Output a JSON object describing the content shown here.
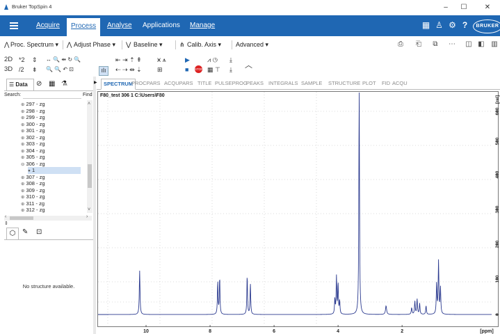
{
  "window": {
    "title": "Bruker TopSpin 4",
    "minimize": "–",
    "maximize": "☐",
    "close": "✕"
  },
  "menu": {
    "items": [
      "Acquire",
      "Process",
      "Analyse",
      "Applications",
      "Manage"
    ],
    "active": "Process",
    "brand": "BRUKER"
  },
  "toolbar1": {
    "proc_spectrum": "Proc. Spectrum ▾",
    "adjust_phase": "Adjust Phase ▾",
    "baseline": "Baseline ▾",
    "calib_axis": "Calib. Axis ▾",
    "advanced": "Advanced ▾"
  },
  "toolbar2": {
    "btn_2d": "2D",
    "btn_3d": "3D",
    "btn_mul2": "*2",
    "btn_div2": "/2",
    "stop": "STOP"
  },
  "left": {
    "tab_data": "Data",
    "search_label": "Search:",
    "find_label": "Find",
    "tree": [
      {
        "label": "297 - zg",
        "pm": "⊕"
      },
      {
        "label": "298 - zg",
        "pm": "⊕"
      },
      {
        "label": "299 - zg",
        "pm": "⊕"
      },
      {
        "label": "300 - zg",
        "pm": "⊕"
      },
      {
        "label": "301 - zg",
        "pm": "⊕"
      },
      {
        "label": "302 - zg",
        "pm": "⊕"
      },
      {
        "label": "303 - zg",
        "pm": "⊕"
      },
      {
        "label": "304 - zg",
        "pm": "⊕"
      },
      {
        "label": "305 - zg",
        "pm": "⊕"
      },
      {
        "label": "306 - zg",
        "pm": "⊖"
      },
      {
        "label": "1",
        "pm": "●"
      },
      {
        "label": "307 - zg",
        "pm": "⊕"
      },
      {
        "label": "308 - zg",
        "pm": "⊕"
      },
      {
        "label": "309 - zg",
        "pm": "⊕"
      },
      {
        "label": "310 - zg",
        "pm": "⊕"
      },
      {
        "label": "311 - zg",
        "pm": "⊕"
      },
      {
        "label": "312 - zg",
        "pm": "⊕"
      }
    ],
    "no_structure": "No structure available."
  },
  "spectrum": {
    "tabs": [
      "SPECTRUM",
      "PROCPARS",
      "ACQUPARS",
      "TITLE",
      "PULSEPROG",
      "PEAKS",
      "INTEGRALS",
      "SAMPLE",
      "STRUCTURE",
      "PLOT",
      "FID",
      "ACQU"
    ],
    "active_tab": "SPECTRUM",
    "dataset": "F80_test 306 1 C:\\Users\\F80",
    "line_color": "#2b3a8f"
  },
  "chart_data": {
    "type": "line",
    "xlabel": "[ppm]",
    "ylabel": "[rel]",
    "xlim": [
      11.5,
      -0.8
    ],
    "xticks": [
      10,
      8,
      6,
      4,
      2
    ],
    "yticks": [
      "0",
      "100",
      "200",
      "300",
      "400",
      "500",
      "600"
    ],
    "peaks": [
      {
        "ppm": 10.2,
        "height": 0.2,
        "width": 0.013
      },
      {
        "ppm": 7.76,
        "height": 0.15,
        "width": 0.012
      },
      {
        "ppm": 7.7,
        "height": 0.17,
        "width": 0.012
      },
      {
        "ppm": 6.84,
        "height": 0.18,
        "width": 0.012
      },
      {
        "ppm": 6.74,
        "height": 0.14,
        "width": 0.012
      },
      {
        "ppm": 4.1,
        "height": 0.07,
        "width": 0.012
      },
      {
        "ppm": 4.05,
        "height": 0.17,
        "width": 0.012
      },
      {
        "ppm": 4.0,
        "height": 0.14,
        "width": 0.012
      },
      {
        "ppm": 3.95,
        "height": 0.06,
        "width": 0.012
      },
      {
        "ppm": 3.34,
        "height": 1.05,
        "width": 0.012
      },
      {
        "ppm": 2.5,
        "height": 0.04,
        "width": 0.02
      },
      {
        "ppm": 1.7,
        "height": 0.03,
        "width": 0.015
      },
      {
        "ppm": 1.6,
        "height": 0.06,
        "width": 0.013
      },
      {
        "ppm": 1.53,
        "height": 0.07,
        "width": 0.013
      },
      {
        "ppm": 1.45,
        "height": 0.05,
        "width": 0.013
      },
      {
        "ppm": 1.25,
        "height": 0.04,
        "width": 0.013
      },
      {
        "ppm": 0.92,
        "height": 0.14,
        "width": 0.013
      },
      {
        "ppm": 0.86,
        "height": 0.24,
        "width": 0.013
      },
      {
        "ppm": 0.8,
        "height": 0.12,
        "width": 0.013
      }
    ]
  }
}
